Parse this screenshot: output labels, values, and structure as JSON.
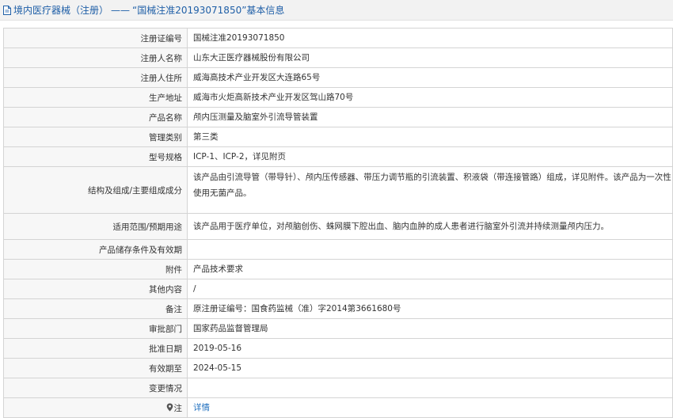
{
  "header": {
    "title_prefix": "境内医疗器械（注册）",
    "separator": "——",
    "title_highlight": "“国械注准20193071850”基本信息"
  },
  "rows": [
    {
      "label": "注册证编号",
      "value": "国械注准20193071850"
    },
    {
      "label": "注册人名称",
      "value": "山东大正医疗器械股份有限公司"
    },
    {
      "label": "注册人住所",
      "value": "威海高技术产业开发区大连路65号"
    },
    {
      "label": "生产地址",
      "value": "威海市火炬高新技术产业开发区驾山路70号"
    },
    {
      "label": "产品名称",
      "value": "颅内压测量及脑室外引流导管装置"
    },
    {
      "label": "管理类别",
      "value": "第三类"
    },
    {
      "label": "型号规格",
      "value": "ICP-1、ICP-2，详见附页"
    },
    {
      "label": "结构及组成/主要组成成分",
      "value": "该产品由引流导管（带导针）、颅内压传感器、带压力调节瓶的引流装置、积液袋（带连接管路）组成，详见附件。该产品为一次性使用无菌产品。"
    },
    {
      "label": "适用范围/预期用途",
      "value": "该产品用于医疗单位，对颅脑创伤、蛛网膜下腔出血、脑内血肿的成人患者进行脑室外引流并持续测量颅内压力。"
    },
    {
      "label": "产品储存条件及有效期",
      "value": ""
    },
    {
      "label": "附件",
      "value": "产品技术要求"
    },
    {
      "label": "其他内容",
      "value": "/"
    },
    {
      "label": "备注",
      "value": "原注册证编号：国食药监械（准）字2014第3661680号"
    },
    {
      "label": "审批部门",
      "value": "国家药品监督管理局"
    },
    {
      "label": "批准日期",
      "value": "2019-05-16"
    },
    {
      "label": "有效期至",
      "value": "2024-05-15"
    },
    {
      "label": "变更情况",
      "value": ""
    }
  ],
  "note_row": {
    "label": "注",
    "link_text": "详情",
    "icon": "pin-icon"
  }
}
